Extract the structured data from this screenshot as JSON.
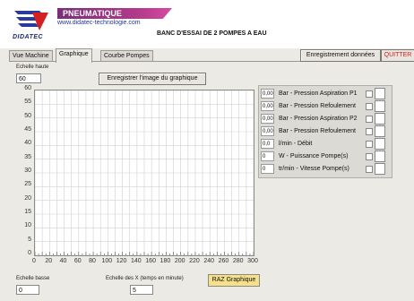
{
  "header": {
    "brand_banner": "PNEUMATIQUE",
    "url": "www.didatec-technologie.com",
    "logo_text": "DIDATEC",
    "title": "BANC D'ESSAI DE 2 POMPES A EAU"
  },
  "tabs": [
    {
      "label": "Vue Machine",
      "active": false
    },
    {
      "label": "Graphique",
      "active": true
    },
    {
      "label": "Courbe Pompes",
      "active": false
    }
  ],
  "toolbar": {
    "save_data_label": "Enregistrement données",
    "quit_label": "QUITTER",
    "save_graph_label": "Enregistrer l'image du graphique",
    "reset_graph_label": "RAZ Graphique"
  },
  "controls": {
    "y_max_label": "Echelle haute",
    "y_max_value": "60",
    "y_min_label": "Echelle basse",
    "y_min_value": "0",
    "x_scale_label": "Echelle des X (temps en minute)",
    "x_scale_value": "5"
  },
  "legend": [
    {
      "value": "0,00",
      "label": "Bar - Pression Aspiration P1"
    },
    {
      "value": "0,00",
      "label": "Bar - Pression Refoulement"
    },
    {
      "value": "0,00",
      "label": "Bar - Pression Aspiration P2"
    },
    {
      "value": "0,00",
      "label": "Bar - Pression Refoulement"
    },
    {
      "value": "0,0",
      "label": "l/min - Débit"
    },
    {
      "value": "0",
      "label": "W - Puissance Pompe(s)"
    },
    {
      "value": "0",
      "label": "tr/min - Vitesse Pompe(s)"
    }
  ],
  "chart_data": {
    "type": "line",
    "x_ticks": [
      "0",
      "20",
      "40",
      "60",
      "80",
      "100",
      "120",
      "140",
      "160",
      "180",
      "200",
      "220",
      "240",
      "260",
      "280",
      "300"
    ],
    "y_ticks": [
      "60",
      "55",
      "50",
      "45",
      "40",
      "35",
      "30",
      "25",
      "20",
      "15",
      "10",
      "5",
      "0"
    ],
    "xlim": [
      0,
      300
    ],
    "ylim": [
      0,
      60
    ],
    "grid": true,
    "series": []
  },
  "colors": {
    "background": "#eceae4",
    "plot_background": "#ffffff",
    "grid": "#d0d0d0",
    "quit_text": "#d42020",
    "reset_button": "#f6e08a",
    "banner": "#b23a8a"
  }
}
